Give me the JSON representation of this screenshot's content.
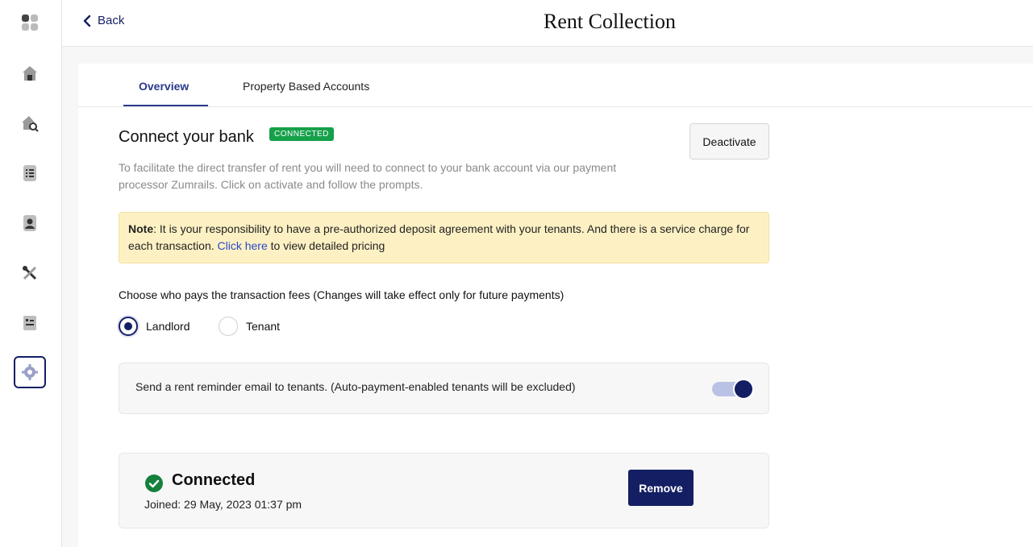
{
  "header": {
    "back_label": "Back",
    "title": "Rent Collection"
  },
  "sidebar": {
    "items": [
      {
        "icon": "apps-grid-icon"
      },
      {
        "icon": "home-icon"
      },
      {
        "icon": "home-search-icon"
      },
      {
        "icon": "list-document-icon"
      },
      {
        "icon": "tenant-contact-icon"
      },
      {
        "icon": "tools-icon"
      },
      {
        "icon": "report-icon"
      },
      {
        "icon": "gear-icon",
        "active": true
      }
    ]
  },
  "tabs": [
    {
      "label": "Overview",
      "active": true
    },
    {
      "label": "Property Based Accounts",
      "active": false
    }
  ],
  "bank": {
    "title": "Connect your bank",
    "badge": "CONNECTED",
    "deactivate_label": "Deactivate",
    "description": "To facilitate the direct transfer of rent you will need to connect to your bank account via our payment processor Zumrails. Click on activate and follow the prompts."
  },
  "note": {
    "label": "Note",
    "text_before": ": It is your responsibility to have a pre-authorized deposit agreement with your tenants. And there is a service charge for each transaction. ",
    "link": "Click here",
    "text_after": " to view detailed pricing"
  },
  "fees": {
    "label": "Choose who pays the transaction fees (Changes will take effect only for future payments)",
    "options": [
      {
        "label": "Landlord",
        "selected": true
      },
      {
        "label": "Tenant",
        "selected": false
      }
    ]
  },
  "reminder": {
    "text": "Send a rent reminder email to tenants. (Auto-payment-enabled tenants will be excluded)",
    "enabled": true
  },
  "connection": {
    "status": "Connected",
    "joined": "Joined: 29 May, 2023 01:37 pm",
    "remove_label": "Remove"
  },
  "colors": {
    "primary": "#141f63",
    "badge": "#15a04a",
    "note_bg": "#fdf1c4",
    "link": "#2a48c8"
  }
}
